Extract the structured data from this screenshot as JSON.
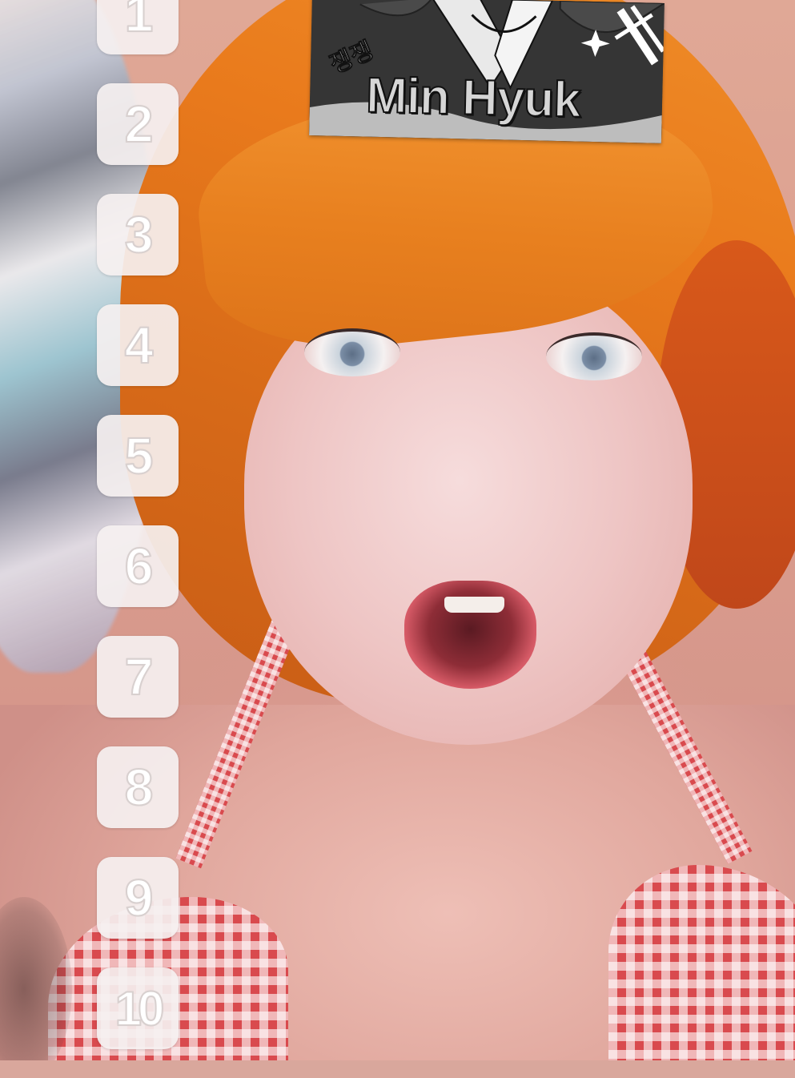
{
  "overlay": {
    "numbers": [
      "1",
      "2",
      "3",
      "4",
      "5",
      "6",
      "7",
      "8",
      "9",
      "10"
    ]
  },
  "sticker": {
    "korean_text": "쟁쟁",
    "name": "Min Hyuk"
  },
  "colors": {
    "hair": "#e97a1c",
    "skin": "#eec5c4",
    "gingham_red": "#d94a4e",
    "number_tile": "#f5f0f0"
  }
}
